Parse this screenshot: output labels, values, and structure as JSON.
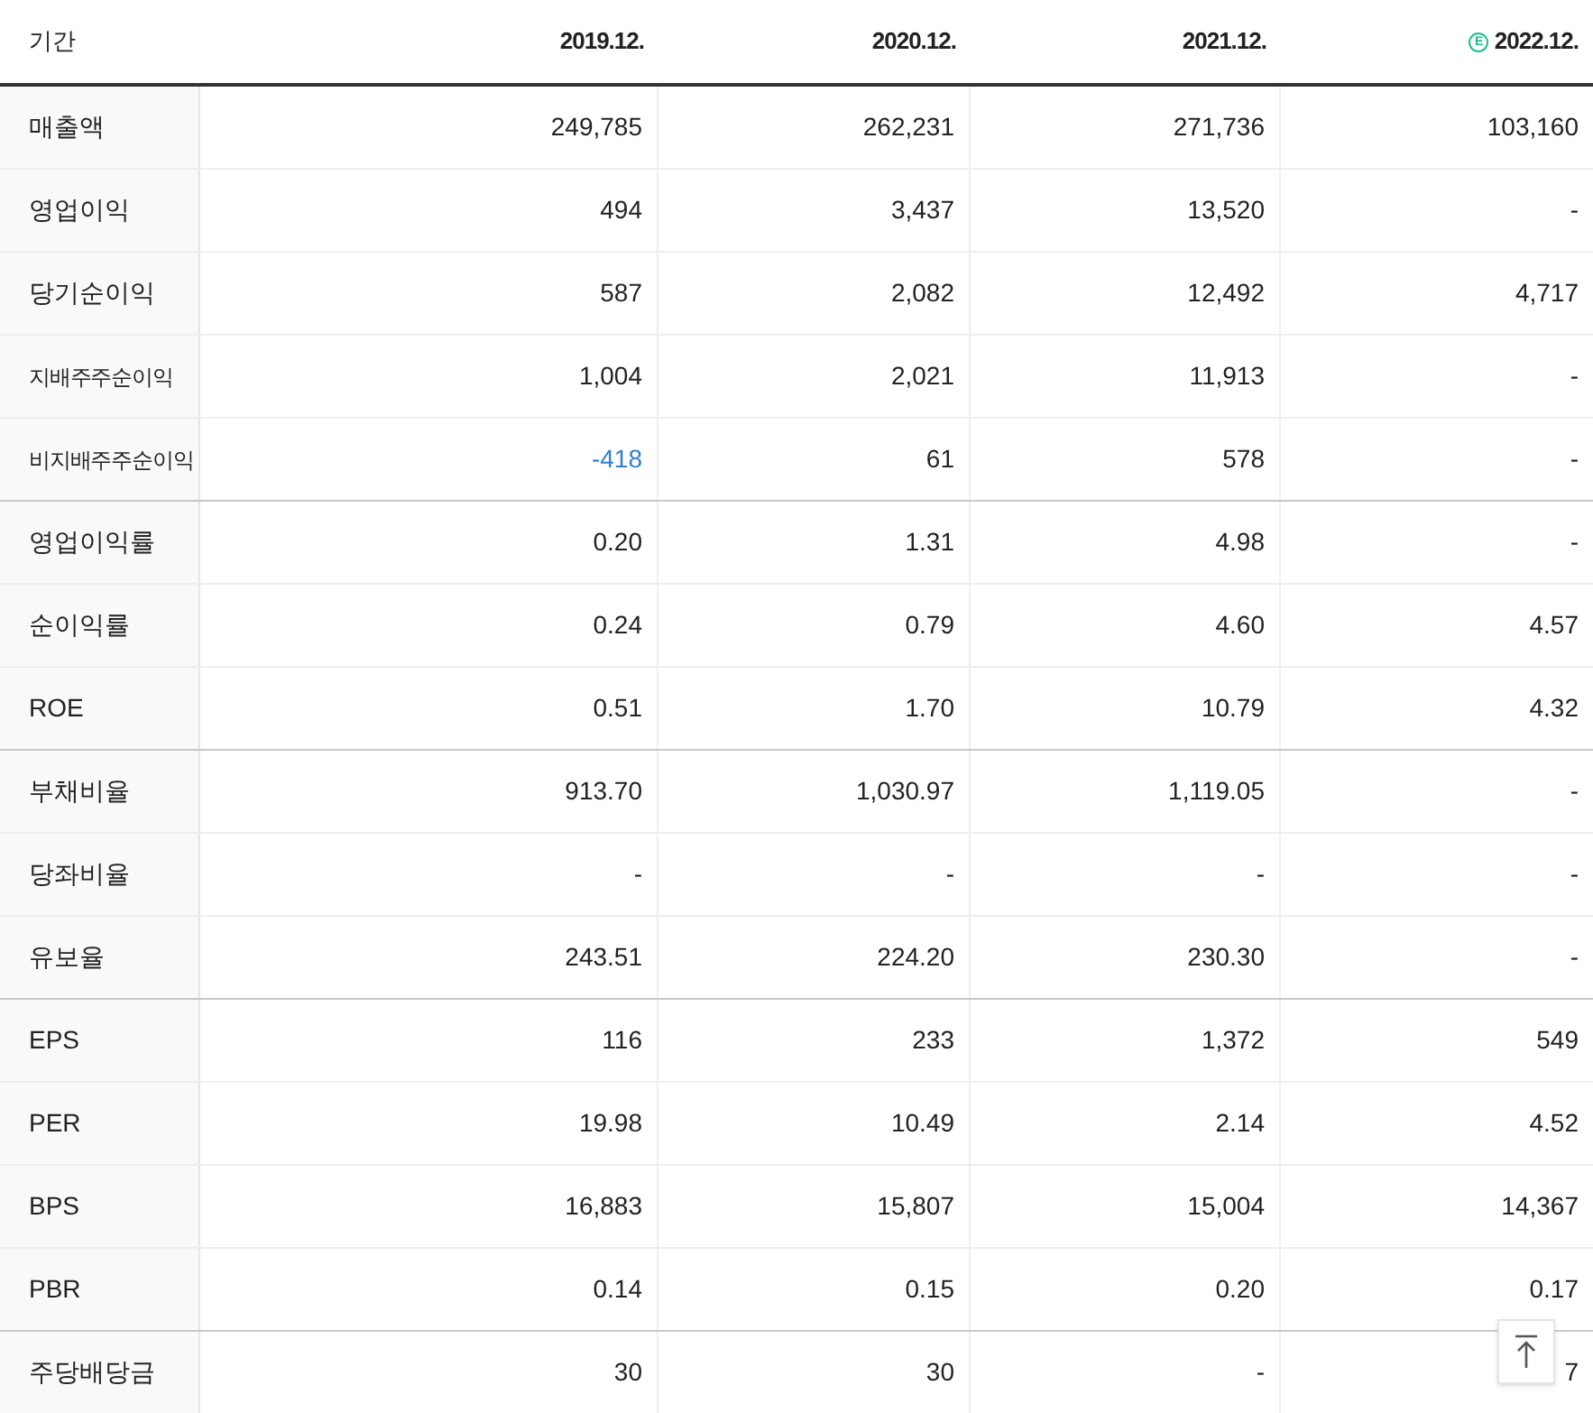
{
  "header": {
    "label": "기간",
    "columns": [
      {
        "text": "2019.12.",
        "estimate": false
      },
      {
        "text": "2020.12.",
        "estimate": false
      },
      {
        "text": "2021.12.",
        "estimate": false
      },
      {
        "text": "2022.12.",
        "estimate": true,
        "estimate_mark": "E"
      }
    ]
  },
  "groups": [
    {
      "rows": [
        {
          "label": "매출액",
          "cells": [
            {
              "text": "249,785",
              "negative": false
            },
            {
              "text": "262,231",
              "negative": false
            },
            {
              "text": "271,736",
              "negative": false
            },
            {
              "text": "103,160",
              "negative": false
            }
          ]
        },
        {
          "label": "영업이익",
          "cells": [
            {
              "text": "494",
              "negative": false
            },
            {
              "text": "3,437",
              "negative": false
            },
            {
              "text": "13,520",
              "negative": false
            },
            {
              "text": "-",
              "negative": false
            }
          ]
        },
        {
          "label": "당기순이익",
          "cells": [
            {
              "text": "587",
              "negative": false
            },
            {
              "text": "2,082",
              "negative": false
            },
            {
              "text": "12,492",
              "negative": false
            },
            {
              "text": "4,717",
              "negative": false
            }
          ]
        },
        {
          "label": "지배주주순이익",
          "cells": [
            {
              "text": "1,004",
              "negative": false
            },
            {
              "text": "2,021",
              "negative": false
            },
            {
              "text": "11,913",
              "negative": false
            },
            {
              "text": "-",
              "negative": false
            }
          ]
        },
        {
          "label": "비지배주주순이익",
          "cells": [
            {
              "text": "-418",
              "negative": true
            },
            {
              "text": "61",
              "negative": false
            },
            {
              "text": "578",
              "negative": false
            },
            {
              "text": "-",
              "negative": false
            }
          ]
        }
      ]
    },
    {
      "rows": [
        {
          "label": "영업이익률",
          "cells": [
            {
              "text": "0.20",
              "negative": false
            },
            {
              "text": "1.31",
              "negative": false
            },
            {
              "text": "4.98",
              "negative": false
            },
            {
              "text": "-",
              "negative": false
            }
          ]
        },
        {
          "label": "순이익률",
          "cells": [
            {
              "text": "0.24",
              "negative": false
            },
            {
              "text": "0.79",
              "negative": false
            },
            {
              "text": "4.60",
              "negative": false
            },
            {
              "text": "4.57",
              "negative": false
            }
          ]
        },
        {
          "label": "ROE",
          "cells": [
            {
              "text": "0.51",
              "negative": false
            },
            {
              "text": "1.70",
              "negative": false
            },
            {
              "text": "10.79",
              "negative": false
            },
            {
              "text": "4.32",
              "negative": false
            }
          ]
        }
      ]
    },
    {
      "rows": [
        {
          "label": "부채비율",
          "cells": [
            {
              "text": "913.70",
              "negative": false
            },
            {
              "text": "1,030.97",
              "negative": false
            },
            {
              "text": "1,119.05",
              "negative": false
            },
            {
              "text": "-",
              "negative": false
            }
          ]
        },
        {
          "label": "당좌비율",
          "cells": [
            {
              "text": "-",
              "negative": false
            },
            {
              "text": "-",
              "negative": false
            },
            {
              "text": "-",
              "negative": false
            },
            {
              "text": "-",
              "negative": false
            }
          ]
        },
        {
          "label": "유보율",
          "cells": [
            {
              "text": "243.51",
              "negative": false
            },
            {
              "text": "224.20",
              "negative": false
            },
            {
              "text": "230.30",
              "negative": false
            },
            {
              "text": "-",
              "negative": false
            }
          ]
        }
      ]
    },
    {
      "rows": [
        {
          "label": "EPS",
          "cells": [
            {
              "text": "116",
              "negative": false
            },
            {
              "text": "233",
              "negative": false
            },
            {
              "text": "1,372",
              "negative": false
            },
            {
              "text": "549",
              "negative": false
            }
          ]
        },
        {
          "label": "PER",
          "cells": [
            {
              "text": "19.98",
              "negative": false
            },
            {
              "text": "10.49",
              "negative": false
            },
            {
              "text": "2.14",
              "negative": false
            },
            {
              "text": "4.52",
              "negative": false
            }
          ]
        },
        {
          "label": "BPS",
          "cells": [
            {
              "text": "16,883",
              "negative": false
            },
            {
              "text": "15,807",
              "negative": false
            },
            {
              "text": "15,004",
              "negative": false
            },
            {
              "text": "14,367",
              "negative": false
            }
          ]
        },
        {
          "label": "PBR",
          "cells": [
            {
              "text": "0.14",
              "negative": false
            },
            {
              "text": "0.15",
              "negative": false
            },
            {
              "text": "0.20",
              "negative": false
            },
            {
              "text": "0.17",
              "negative": false
            }
          ]
        }
      ]
    },
    {
      "rows": [
        {
          "label": "주당배당금",
          "cells": [
            {
              "text": "30",
              "negative": false
            },
            {
              "text": "30",
              "negative": false
            },
            {
              "text": "-",
              "negative": false
            },
            {
              "text": "7",
              "negative": false
            }
          ]
        }
      ]
    }
  ]
}
